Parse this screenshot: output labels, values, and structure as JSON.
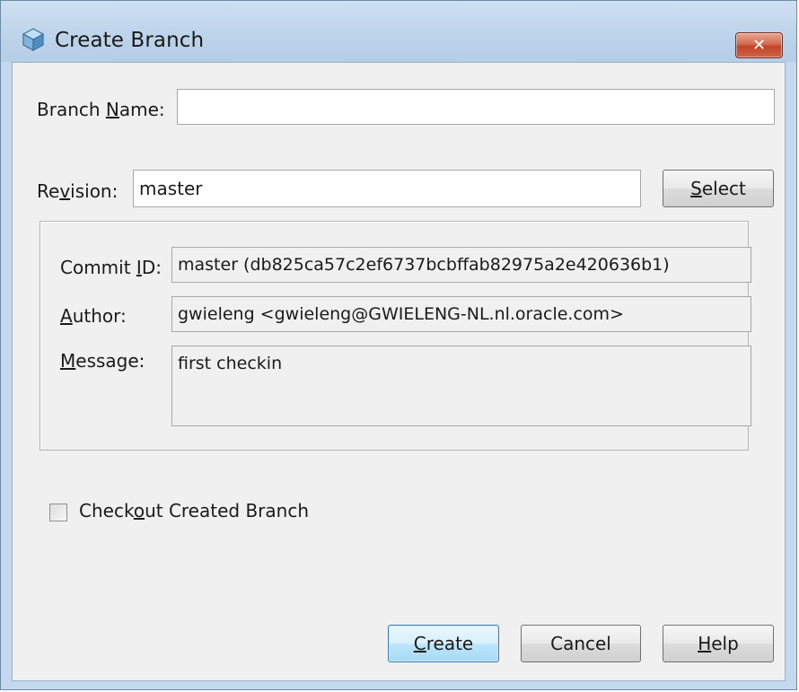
{
  "window": {
    "title": "Create Branch",
    "close_label": "✕"
  },
  "branch_name": {
    "label_pre": "Branch ",
    "label_accel": "N",
    "label_post": "ame:",
    "value": ""
  },
  "revision": {
    "label_pre": "Re",
    "label_accel": "v",
    "label_post": "ision:",
    "value": "master",
    "select_accel": "S",
    "select_rest": "elect"
  },
  "details": {
    "commit_id_pre": "Commit ",
    "commit_id_accel": "I",
    "commit_id_post": "D:",
    "commit_id_value": "master (db825ca57c2ef6737bcbffab82975a2e420636b1)",
    "author_accel": "A",
    "author_post": "uthor:",
    "author_value": "gwieleng <gwieleng@GWIELENG-NL.nl.oracle.com>",
    "message_accel": "M",
    "message_post": "essage:",
    "message_value": "first checkin"
  },
  "checkout": {
    "label_pre": "Check",
    "label_accel": "o",
    "label_post": "ut Created Branch",
    "checked": false
  },
  "buttons": {
    "create_accel": "C",
    "create_rest": "reate",
    "cancel": "Cancel",
    "help_accel": "H",
    "help_rest": "elp"
  }
}
